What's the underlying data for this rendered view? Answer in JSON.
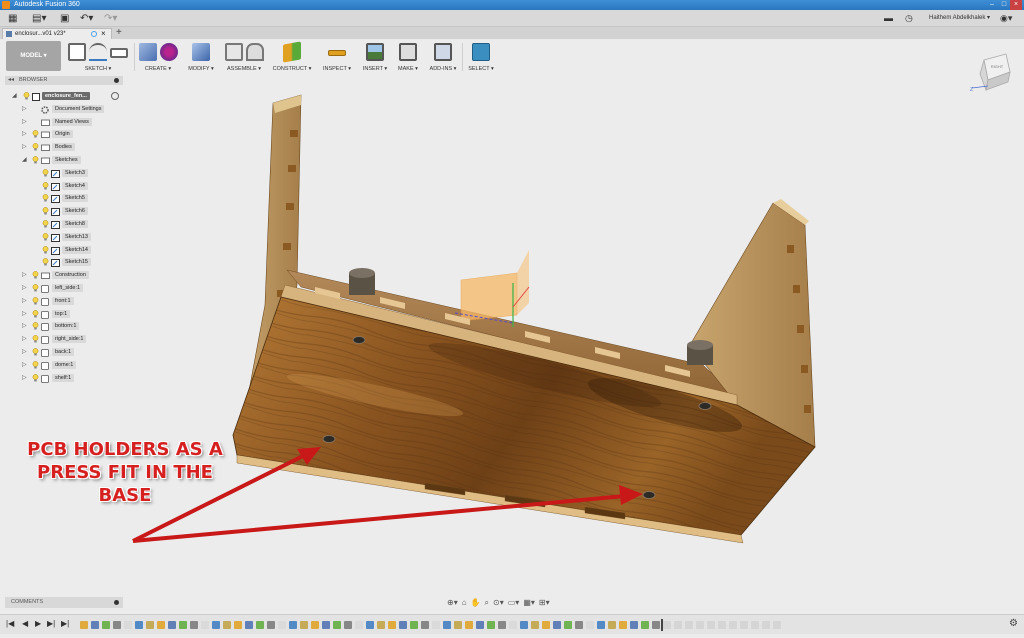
{
  "app": {
    "title": "Autodesk Fusion 360",
    "user": "Haithem Abdelkhalek"
  },
  "document": {
    "tab_name": "enclosur...v01 v23*"
  },
  "toolbar": {
    "workspace": "MODEL",
    "groups": [
      "SKETCH",
      "CREATE",
      "MODIFY",
      "ASSEMBLE",
      "CONSTRUCT",
      "INSPECT",
      "INSERT",
      "MAKE",
      "ADD-INS",
      "SELECT"
    ]
  },
  "viewcube": {
    "face_label": "RIGHT",
    "axis_label": "Z"
  },
  "browser": {
    "title": "BROWSER",
    "root": "enclosure_fen...",
    "items": [
      {
        "label": "Document Settings",
        "icon": "gear-icon"
      },
      {
        "label": "Named Views",
        "icon": "folder-icon"
      },
      {
        "label": "Origin",
        "icon": "folder-icon"
      },
      {
        "label": "Bodies",
        "icon": "folder-icon"
      },
      {
        "label": "Sketches",
        "icon": "folder-icon"
      },
      {
        "label": "Sketch3",
        "icon": "sketch-icon"
      },
      {
        "label": "Sketch4",
        "icon": "sketch-icon"
      },
      {
        "label": "Sketch5",
        "icon": "sketch-icon"
      },
      {
        "label": "Sketch6",
        "icon": "sketch-icon"
      },
      {
        "label": "Sketch8",
        "icon": "sketch-icon"
      },
      {
        "label": "Sketch13",
        "icon": "sketch-icon"
      },
      {
        "label": "Sketch14",
        "icon": "sketch-icon"
      },
      {
        "label": "Sketch15",
        "icon": "sketch-icon"
      },
      {
        "label": "Construction",
        "icon": "folder-icon"
      },
      {
        "label": "left_side:1",
        "icon": "component-icon"
      },
      {
        "label": "front:1",
        "icon": "component-icon"
      },
      {
        "label": "top:1",
        "icon": "component-icon"
      },
      {
        "label": "bottom:1",
        "icon": "component-icon"
      },
      {
        "label": "right_side:1",
        "icon": "component-icon"
      },
      {
        "label": "back:1",
        "icon": "component-icon"
      },
      {
        "label": "dome:1",
        "icon": "component-icon"
      },
      {
        "label": "shelf:1",
        "icon": "component-icon"
      }
    ]
  },
  "comments": {
    "title": "COMMENTS"
  },
  "annotation": {
    "lines": [
      "PCB HOLDERS AS A",
      "PRESS FIT IN THE",
      "BASE"
    ],
    "color": "#d62020"
  },
  "colors": {
    "titlebar": "#2a76bf",
    "wood": "#8a5a24",
    "select_accent": "#3a8fc0"
  }
}
